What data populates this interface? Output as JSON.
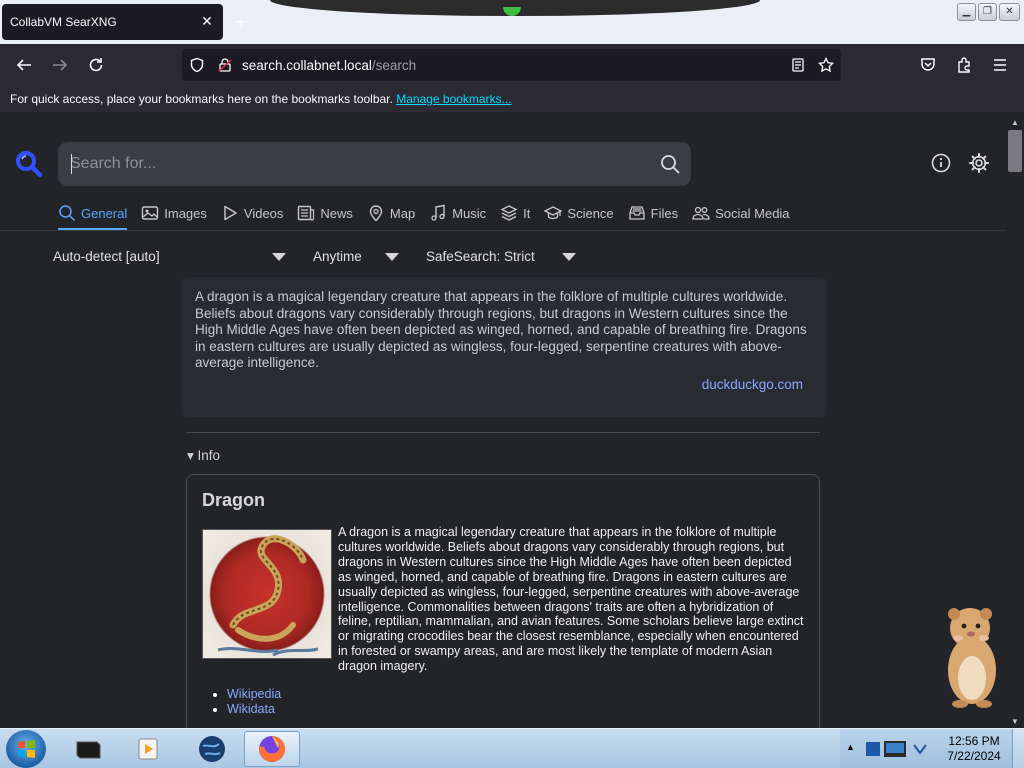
{
  "browser": {
    "tab_title": "CollabVM SearXNG",
    "url_host": "search.collabnet.local",
    "url_path": "/search",
    "bookmarks_message": "For quick access, place your bookmarks here on the bookmarks toolbar.",
    "bookmarks_link": "Manage bookmarks..."
  },
  "search": {
    "placeholder": "Search for...",
    "categories": [
      {
        "label": "General",
        "icon": "search-icon",
        "active": true
      },
      {
        "label": "Images",
        "icon": "image-icon"
      },
      {
        "label": "Videos",
        "icon": "play-icon"
      },
      {
        "label": "News",
        "icon": "newspaper-icon"
      },
      {
        "label": "Map",
        "icon": "map-pin-icon"
      },
      {
        "label": "Music",
        "icon": "music-icon"
      },
      {
        "label": "It",
        "icon": "layers-icon"
      },
      {
        "label": "Science",
        "icon": "school-icon"
      },
      {
        "label": "Files",
        "icon": "file-tray-icon"
      },
      {
        "label": "Social Media",
        "icon": "people-icon"
      }
    ],
    "filters": {
      "language": "Auto-detect [auto]",
      "time": "Anytime",
      "safesearch": "SafeSearch: Strict"
    }
  },
  "answer": {
    "text": "A dragon is a magical legendary creature that appears in the folklore of multiple cultures worldwide. Beliefs about dragons vary considerably through regions, but dragons in Western cultures since the High Middle Ages have often been depicted as winged, horned, and capable of breathing fire. Dragons in eastern cultures are usually depicted as wingless, four-legged, serpentine creatures with above-average intelligence.",
    "source": "duckduckgo.com"
  },
  "infobox": {
    "toggle": "▾ Info",
    "title": "Dragon",
    "text": "A dragon is a magical legendary creature that appears in the folklore of multiple cultures worldwide. Beliefs about dragons vary considerably through regions, but dragons in Western cultures since the High Middle Ages have often been depicted as winged, horned, and capable of breathing fire. Dragons in eastern cultures are usually depicted as wingless, four-legged, serpentine creatures with above-average intelligence. Commonalities between dragons' traits are often a hybridization of feline, reptilian, mammalian, and avian features. Some scholars believe large extinct or migrating crocodiles bear the closest resemblance, especially when encountered in forested or swampy areas, and are most likely the template of modern Asian dragon imagery.",
    "links": [
      "Wikipedia",
      "Wikidata"
    ]
  },
  "taskbar": {
    "time": "12:56 PM",
    "date": "7/22/2024"
  },
  "colors": {
    "accent": "#58a6ff",
    "link": "#8aa8ff",
    "page_bg": "#222428"
  }
}
